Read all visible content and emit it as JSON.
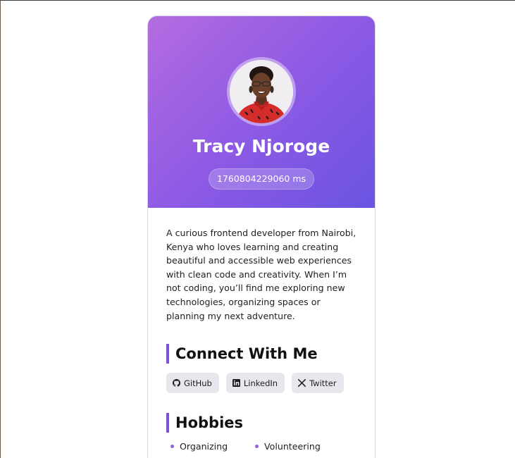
{
  "profile": {
    "name": "Tracy Njoroge",
    "time": "1760804229060 ms",
    "avatar_alt": "avatar-photo",
    "bio": "A curious frontend developer from Nairobi, Kenya who loves learning and creating beautiful and accessible web experiences with clean code and creativity. When I’m not coding, you’ll find me exploring new technologies, organizing spaces or planning my next adventure."
  },
  "connect": {
    "title": "Connect With Me",
    "links": [
      {
        "label": "GitHub",
        "icon": "github-icon"
      },
      {
        "label": "LinkedIn",
        "icon": "linkedin-icon"
      },
      {
        "label": "Twitter",
        "icon": "x-icon"
      }
    ]
  },
  "hobbies": {
    "title": "Hobbies",
    "items": [
      "Organizing",
      "Volunteering"
    ]
  },
  "colors": {
    "gradient_start": "#b46ce0",
    "gradient_end": "#6a54e2",
    "accent": "#7b52d9"
  }
}
